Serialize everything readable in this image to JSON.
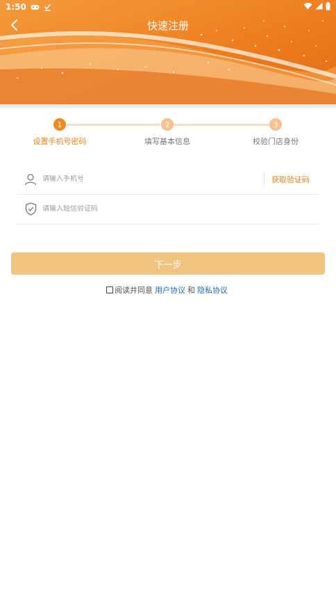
{
  "statusbar": {
    "time": "1:50"
  },
  "header": {
    "title": "快速注册"
  },
  "steps": [
    {
      "number": "1",
      "label": "设置手机号密码",
      "active": true
    },
    {
      "number": "2",
      "label": "填写基本信息",
      "active": false
    },
    {
      "number": "3",
      "label": "校验门店身份",
      "active": false
    }
  ],
  "form": {
    "phone_placeholder": "请输入手机号",
    "get_code_label": "获取验证码",
    "sms_placeholder": "请输入短信验证码"
  },
  "next_button_label": "下一步",
  "agreement": {
    "prefix": "阅读并同意",
    "user_agreement": "用户协议",
    "conjunction": "和",
    "privacy_agreement": "隐私协议"
  },
  "colors": {
    "accent": "#e98419",
    "step_active": "#f08a1c",
    "step_inactive": "#f6c18c",
    "button": "#f0c47e",
    "link": "#1f67c2"
  }
}
